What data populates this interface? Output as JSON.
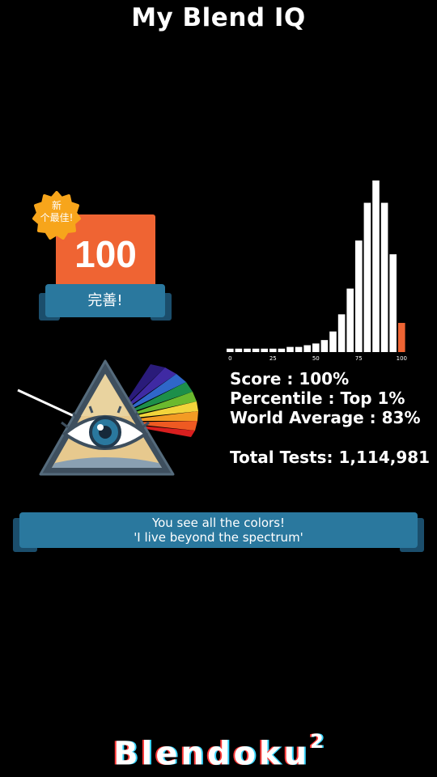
{
  "header": {
    "title": "My Blend IQ"
  },
  "score_card": {
    "value": "100",
    "badge_line1": "新",
    "badge_line2": "个最佳!",
    "rating": "完善!"
  },
  "histogram": {
    "axis_labels": [
      "0",
      "25",
      "50",
      "75",
      "100"
    ],
    "bar_levels": [
      0.02,
      0.02,
      0.02,
      0.02,
      0.02,
      0.02,
      0.02,
      0.03,
      0.03,
      0.04,
      0.05,
      0.07,
      0.12,
      0.22,
      0.37,
      0.65,
      0.87,
      1.0,
      0.87,
      0.57,
      0.17
    ],
    "bar_color": "#ffffff",
    "highlight_color": "#ef6433"
  },
  "stats": {
    "score": "Score : 100%",
    "percentile": "Percentile : Top 1%",
    "world_average": "World Average : 83%",
    "total_tests": "Total Tests: 1,114,981"
  },
  "message": {
    "line1": "You see all the colors!",
    "line2": "'I live beyond the spectrum'"
  },
  "footer": {
    "logo": "Blendoku",
    "logo_sup": "2"
  },
  "colors": {
    "accent_orange": "#ef6433",
    "banner_blue": "#2a789e",
    "banner_dark": "#1b4e6c"
  },
  "icons": {
    "prism": "all-seeing-eye-prism-icon",
    "badge": "new-best-star-badge-icon"
  }
}
